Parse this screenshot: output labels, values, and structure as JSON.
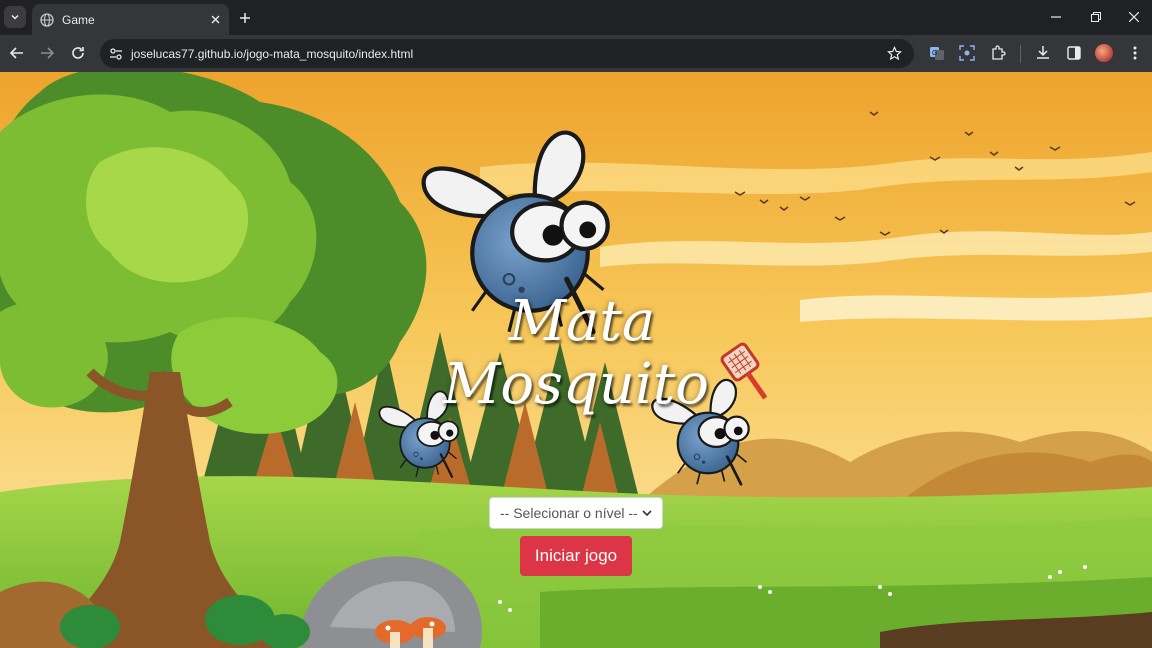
{
  "browser": {
    "tab_title": "Game",
    "url": "joselucas77.github.io/jogo-mata_mosquito/index.html"
  },
  "game": {
    "title_line1": "Mata",
    "title_line2": "Mosquito",
    "level_select_value": "-- Selecionar o nível --",
    "start_button_label": "Iniciar jogo"
  },
  "colors": {
    "start_button": "#dc3545",
    "sky_top": "#f2a531",
    "sky_bottom": "#fde7a3",
    "grass": "#7cc23a",
    "mosquito_body": "#4f7aa8"
  },
  "icons": [
    "tab-search-icon",
    "globe-icon",
    "close-icon",
    "plus-icon",
    "minimize-icon",
    "restore-icon",
    "back-icon",
    "forward-icon",
    "reload-icon",
    "site-info-icon",
    "star-icon",
    "translate-icon",
    "lens-icon",
    "extensions-icon",
    "download-icon",
    "sidepanel-icon",
    "menu-icon"
  ]
}
